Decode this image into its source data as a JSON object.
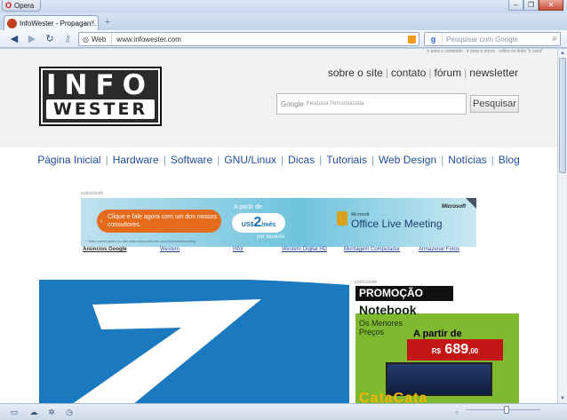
{
  "browser": {
    "menu_label": "Opera",
    "tab_title": "InfoWester - Propagan...",
    "address_label": "Web",
    "url": "www.infowester.com",
    "search_placeholder": "Pesquisar com Google",
    "window_controls": [
      "minimize-icon",
      "restore-icon",
      "close-icon"
    ],
    "zoom_fraction": 0.55
  },
  "site": {
    "skip_links": "ir para o conteúdo . ir para o menu . sobre os links \"ir para\"",
    "logo_line1": "INFO",
    "logo_line2": "WESTER",
    "top_links": [
      "sobre o site",
      "contato",
      "fórum",
      "newsletter"
    ],
    "search_hint": "Pesquisa Personalizada",
    "search_google_mark": "Google",
    "search_button": "Pesquisar",
    "menu": [
      "Página Inicial",
      "Hardware",
      "Software",
      "GNU/Linux",
      "Dicas",
      "Tutoriais",
      "Web Design",
      "Notícias",
      "Blog"
    ],
    "ad_label": "publicidade",
    "banner": {
      "cta": "Clique e fale agora com um dos nossos consultores.",
      "from": "A partir de",
      "price_currency": "US$",
      "price": "2",
      "price_unit": "/mês",
      "price_note": "por usuário!",
      "brand": "Microsoft",
      "product_prefix": "Microsoft",
      "product": "Office Live Meeting",
      "fine_print": "* Mais informações no site www.microsoft.com.br/online/liveinmeeting"
    },
    "ad_links": [
      "Anúncios Google",
      "Western",
      "Infor",
      "Western Digital HD",
      "Montagem Computador",
      "Armazenar Fotos"
    ],
    "side_ad_label": "publicidade",
    "side_ad": {
      "promo": "PROMOÇÃO",
      "product": "Notebook",
      "tagline": "Os Menores Preços",
      "from": "A partir de",
      "currency": "R$",
      "price": "689",
      "cents": ",00",
      "store": "CataCata"
    }
  }
}
